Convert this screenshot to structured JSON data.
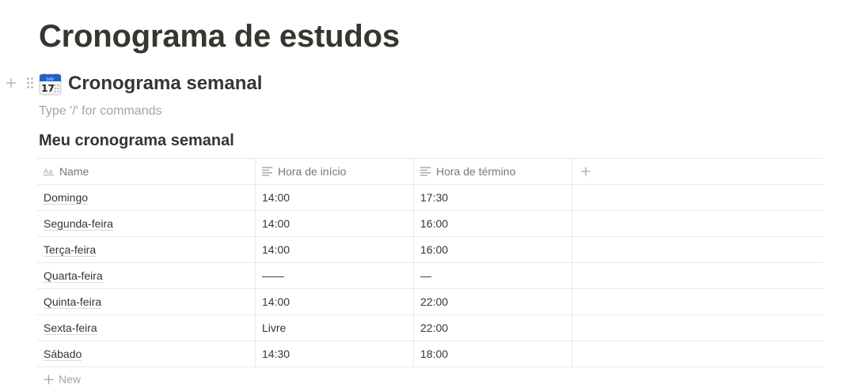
{
  "page": {
    "title": "Cronograma de estudos"
  },
  "section": {
    "icon": "calendar-icon",
    "heading": "Cronograma semanal",
    "placeholder": "Type '/' for commands"
  },
  "database": {
    "title": "Meu cronograma semanal",
    "columns": [
      {
        "label": "Name",
        "icon": "title-aa-icon"
      },
      {
        "label": "Hora de início",
        "icon": "text-lines-icon"
      },
      {
        "label": "Hora de término",
        "icon": "text-lines-icon"
      }
    ],
    "add_column_icon": "plus-icon",
    "rows": [
      {
        "name": "Domingo",
        "start": "14:00",
        "end": "17:30"
      },
      {
        "name": "Segunda-feira",
        "start": "14:00",
        "end": "16:00"
      },
      {
        "name": "Terça-feira",
        "start": "14:00",
        "end": "16:00"
      },
      {
        "name": "Quarta-feira",
        "start": "——",
        "end": "—"
      },
      {
        "name": "Quinta-feira",
        "start": "14:00",
        "end": "22:00"
      },
      {
        "name": "Sexta-feira",
        "start": "Livre",
        "end": "22:00"
      },
      {
        "name": "Sábado",
        "start": "14:30",
        "end": "18:00"
      }
    ],
    "new_label": "New"
  }
}
